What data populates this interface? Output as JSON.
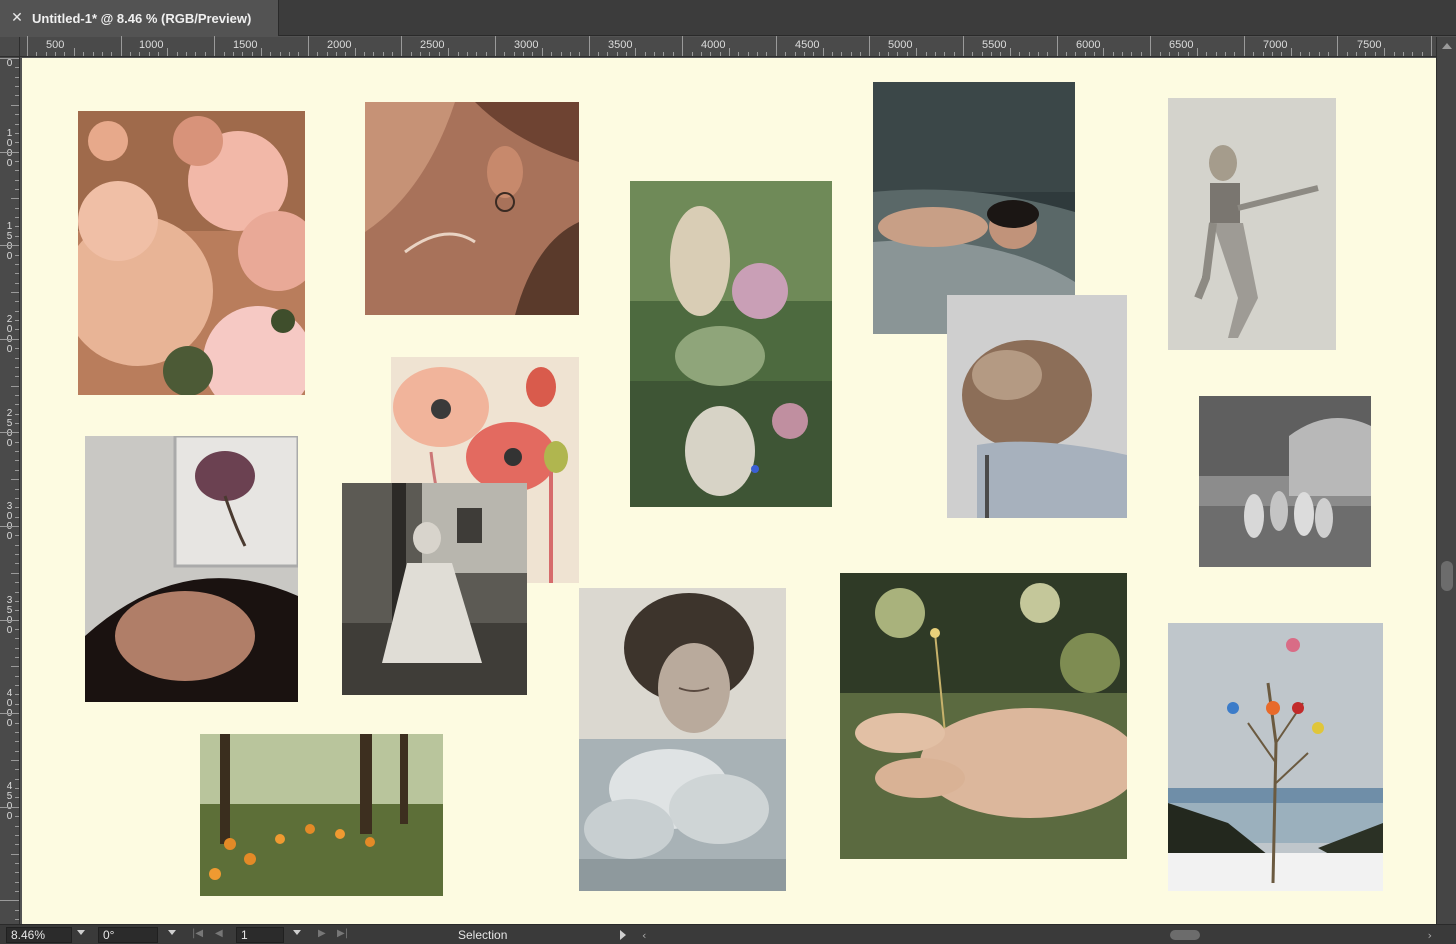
{
  "document": {
    "tab_title": "Untitled-1* @ 8.46 % (RGB/Preview)",
    "close_glyph": "✕"
  },
  "ruler": {
    "horizontal_labels": [
      "500",
      "1000",
      "1500",
      "2000",
      "2500",
      "3000",
      "3500",
      "4000",
      "4500",
      "5000",
      "5500",
      "6000",
      "6500",
      "7000",
      "7500"
    ],
    "vertical_labels": [
      "0",
      "1000",
      "1500",
      "2000",
      "2500",
      "3000",
      "3500",
      "4000",
      "4500"
    ]
  },
  "canvas": {
    "background": "#fdfbe1",
    "photos": [
      {
        "name": "pink-flowers-photo"
      },
      {
        "name": "neck-earring-photo"
      },
      {
        "name": "running-girls-flowers-photo"
      },
      {
        "name": "sleeping-woman-photo"
      },
      {
        "name": "dancing-woman-photo"
      },
      {
        "name": "poppy-painting-photo"
      },
      {
        "name": "back-flower-art-photo"
      },
      {
        "name": "woman-forest-dress-photo"
      },
      {
        "name": "hair-on-chair-photo"
      },
      {
        "name": "circle-dance-photo"
      },
      {
        "name": "woman-face-portrait-photo"
      },
      {
        "name": "clouds-photo"
      },
      {
        "name": "hand-holding-flower-photo"
      },
      {
        "name": "flower-branch-snow-photo"
      },
      {
        "name": "orange-poppies-forest-photo"
      }
    ]
  },
  "statusbar": {
    "zoom_value": "8.46%",
    "rotation_value": "0°",
    "page_value": "1",
    "status_text": "Selection",
    "nav_first": "|◀",
    "nav_prev": "◀",
    "nav_next": "▶",
    "nav_last": "▶|",
    "scroll_left": "‹",
    "scroll_right": "›"
  }
}
